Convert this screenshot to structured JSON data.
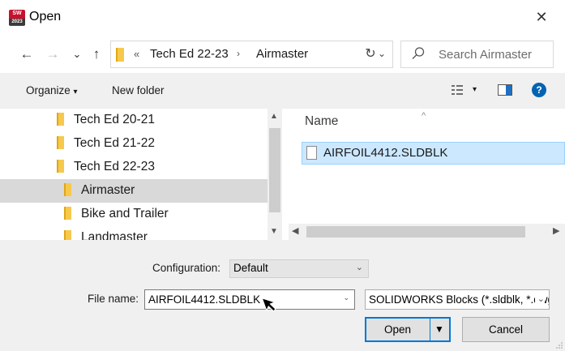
{
  "window": {
    "title": "Open",
    "app_icon_text": "SW",
    "app_icon_year": "2023",
    "close_glyph": "✕"
  },
  "address": {
    "back_glyph": "←",
    "forward_glyph": "→",
    "recent_glyph": "⌄",
    "up_glyph": "↑",
    "overflow": "«",
    "crumbs": [
      "Tech Ed 22-23",
      "Airmaster"
    ],
    "separator": "›",
    "dropdown_glyph": "⌄",
    "refresh_glyph": "↻"
  },
  "search": {
    "placeholder": "Search Airmaster"
  },
  "toolbar": {
    "organize": "Organize",
    "organize_arrow": "▾",
    "new_folder": "New folder",
    "view_arrow": "▾",
    "help": "?"
  },
  "tree": {
    "items": [
      {
        "label": "Tech Ed 20-21"
      },
      {
        "label": "Tech Ed 21-22"
      },
      {
        "label": "Tech Ed 22-23"
      },
      {
        "label": "Airmaster"
      },
      {
        "label": "Bike and Trailer"
      },
      {
        "label": "Landmaster"
      }
    ],
    "selected_index": 3
  },
  "files": {
    "column_header": "Name",
    "items": [
      {
        "name": "AIRFOIL4412.SLDBLK"
      }
    ]
  },
  "bottom": {
    "configuration_label": "Configuration:",
    "configuration_value": "Default",
    "file_name_label": "File name:",
    "file_name_value": "AIRFOIL4412.SLDBLK",
    "file_type_value": "SOLIDWORKS Blocks (*.sldblk, *.dwg)",
    "open_label": "Open",
    "cancel_label": "Cancel"
  },
  "colors": {
    "accent": "#0078d7",
    "selection_bg": "#cce8ff",
    "tree_selected_bg": "#d9d9d9",
    "folder": "#f6c94c",
    "help_icon": "#0063b1"
  },
  "icons": [
    "app-icon",
    "close-icon",
    "back-icon",
    "forward-icon",
    "up-icon",
    "folder-icon",
    "refresh-icon",
    "search-icon",
    "view-options-icon",
    "preview-pane-icon",
    "help-icon",
    "file-icon",
    "mouse-pointer-icon"
  ]
}
